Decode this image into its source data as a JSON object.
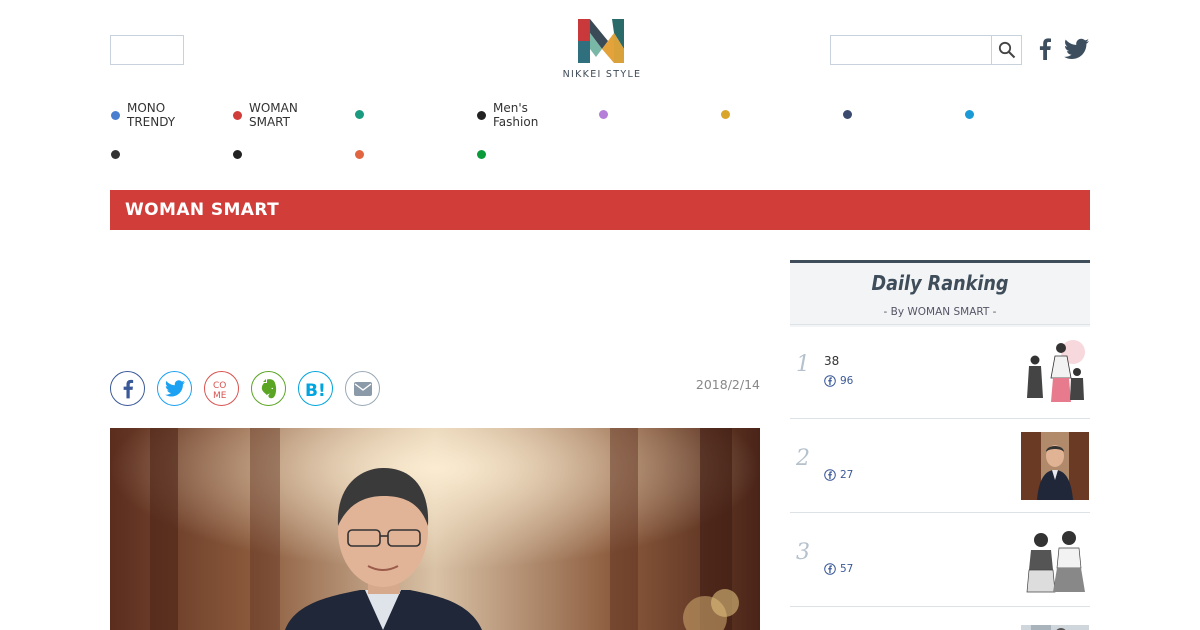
{
  "header": {
    "logo_text": "NIKKEI STYLE",
    "search_placeholder": ""
  },
  "nav": {
    "items": [
      {
        "label": "MONO\nTRENDY",
        "color": "#4a7fd0"
      },
      {
        "label": "WOMAN\nSMART",
        "color": "#d13e39"
      },
      {
        "label": "",
        "color": "#1a9a7e"
      },
      {
        "label": "Men's\nFashion",
        "color": "#222222"
      },
      {
        "label": "",
        "color": "#b57ed9"
      },
      {
        "label": "",
        "color": "#d9a52b"
      },
      {
        "label": "",
        "color": "#3b4a6e"
      },
      {
        "label": "",
        "color": "#1a9ad6"
      },
      {
        "label": "",
        "color": "#333333"
      },
      {
        "label": "",
        "color": "#222222"
      },
      {
        "label": "",
        "color": "#e06540"
      },
      {
        "label": "",
        "color": "#0a9a3a"
      }
    ]
  },
  "section": {
    "title": "WOMAN SMART",
    "color": "#d13e39"
  },
  "article": {
    "date": "2018/2/14"
  },
  "share": [
    {
      "name": "facebook-share-button",
      "icon": "facebook-icon",
      "color": "#3b5998"
    },
    {
      "name": "twitter-share-button",
      "icon": "twitter-icon",
      "color": "#1da1f2"
    },
    {
      "name": "come-share-button",
      "icon": "come-icon",
      "color": "#d9534f"
    },
    {
      "name": "evernote-share-button",
      "icon": "evernote-icon",
      "color": "#5ba525"
    },
    {
      "name": "hatena-share-button",
      "icon": "hatena-bookmark-icon",
      "color": "#00a4de"
    },
    {
      "name": "mail-share-button",
      "icon": "mail-icon",
      "color": "#8a9aa8"
    }
  ],
  "ranking": {
    "title": "Daily Ranking",
    "subtitle": "- By WOMAN SMART -",
    "items": [
      {
        "rank": "1",
        "text": "38",
        "fb_count": "96"
      },
      {
        "rank": "2",
        "text": "",
        "fb_count": "27"
      },
      {
        "rank": "3",
        "text": "",
        "fb_count": "57"
      }
    ]
  }
}
